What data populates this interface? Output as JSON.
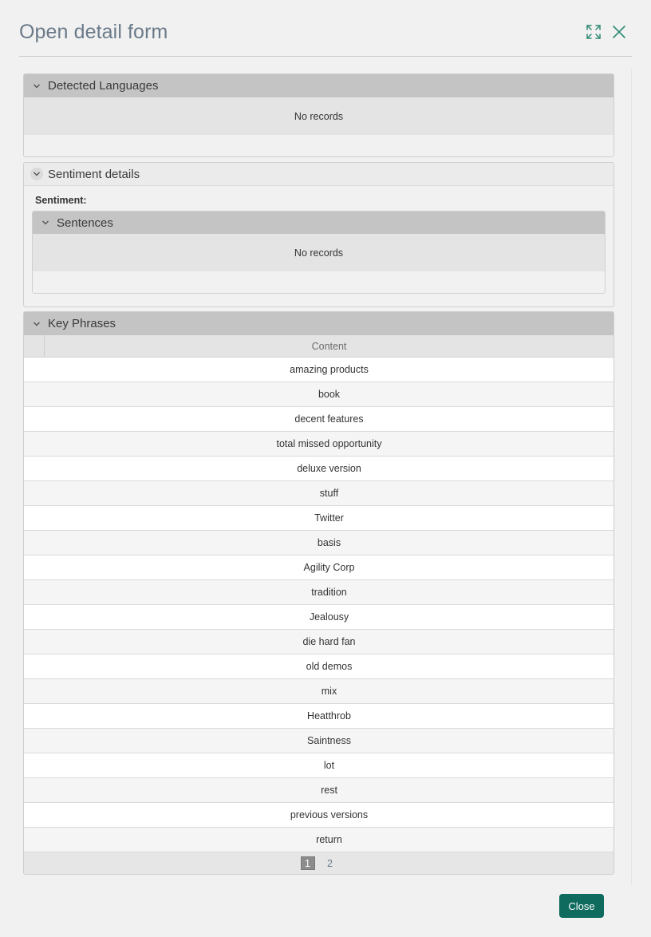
{
  "dialog": {
    "title": "Open detail form",
    "close_label": "Close"
  },
  "detected_languages": {
    "title": "Detected Languages",
    "empty_text": "No records"
  },
  "sentiment_details": {
    "title": "Sentiment details",
    "sentiment_label": "Sentiment:",
    "sentences": {
      "title": "Sentences",
      "empty_text": "No records"
    }
  },
  "key_phrases": {
    "title": "Key Phrases",
    "column_header": "Content",
    "rows": [
      "amazing products",
      "book",
      "decent features",
      "total missed opportunity",
      "deluxe version",
      "stuff",
      "Twitter",
      "basis",
      "Agility Corp",
      "tradition",
      "Jealousy",
      "die hard fan",
      "old demos",
      "mix",
      "Heatthrob",
      "Saintness",
      "lot",
      "rest",
      "previous versions",
      "return"
    ],
    "pages": [
      "1",
      "2"
    ],
    "current_page": "1"
  },
  "icons": {
    "maximize": "maximize-icon",
    "close": "close-icon",
    "collapse": "chevron-down-icon"
  },
  "colors": {
    "accent": "#0e6b5e",
    "title_text": "#6b7a8a",
    "panel_header": "#c4c4c4"
  }
}
